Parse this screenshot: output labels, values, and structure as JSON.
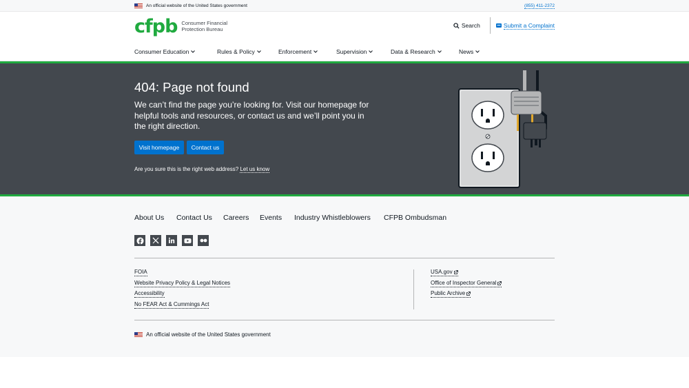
{
  "gov_banner": {
    "text": "An official website of the United States government",
    "phone": "(855) 411-2372"
  },
  "header": {
    "logo_mark": "cfpb",
    "logo_text": "Consumer Financial Protection Bureau",
    "search_label": "Search",
    "complaint_label": "Submit a Complaint"
  },
  "nav": {
    "items": [
      {
        "label": "Consumer Education"
      },
      {
        "label": "Rules & Policy"
      },
      {
        "label": "Enforcement"
      },
      {
        "label": "Supervision"
      },
      {
        "label": "Data & Research"
      },
      {
        "label": "News"
      }
    ]
  },
  "hero": {
    "title": "404: Page not found",
    "lead": "We can’t find the page you’re looking for. Visit our homepage for helpful tools and resources, or contact us and we’ll point you in the right direction.",
    "btn_home": "Visit homepage",
    "btn_contact": "Contact us",
    "question": "Are you sure this is the right web address?",
    "question_link": "Let us know"
  },
  "footer": {
    "nav": [
      {
        "label": "About Us"
      },
      {
        "label": "Contact Us"
      },
      {
        "label": "Careers"
      },
      {
        "label": "Events"
      },
      {
        "label": "Industry Whistleblowers"
      },
      {
        "label": "CFPB Ombudsman"
      }
    ],
    "social": [
      "facebook-icon",
      "x-icon",
      "linkedin-icon",
      "youtube-icon",
      "flickr-icon"
    ],
    "left_links": [
      {
        "label": "FOIA"
      },
      {
        "label": "Website Privacy Policy & Legal Notices"
      },
      {
        "label": "Accessibility"
      },
      {
        "label": "No FEAR Act & Cummings Act"
      }
    ],
    "right_links": [
      {
        "label": "USA.gov"
      },
      {
        "label": "Office of Inspector General"
      },
      {
        "label": "Public Archive"
      }
    ],
    "gov_text": "An official website of the United States government"
  },
  "colors": {
    "brand_green": "#20aa3f",
    "link_blue": "#0072ce",
    "hero_gray": "#43484e"
  }
}
